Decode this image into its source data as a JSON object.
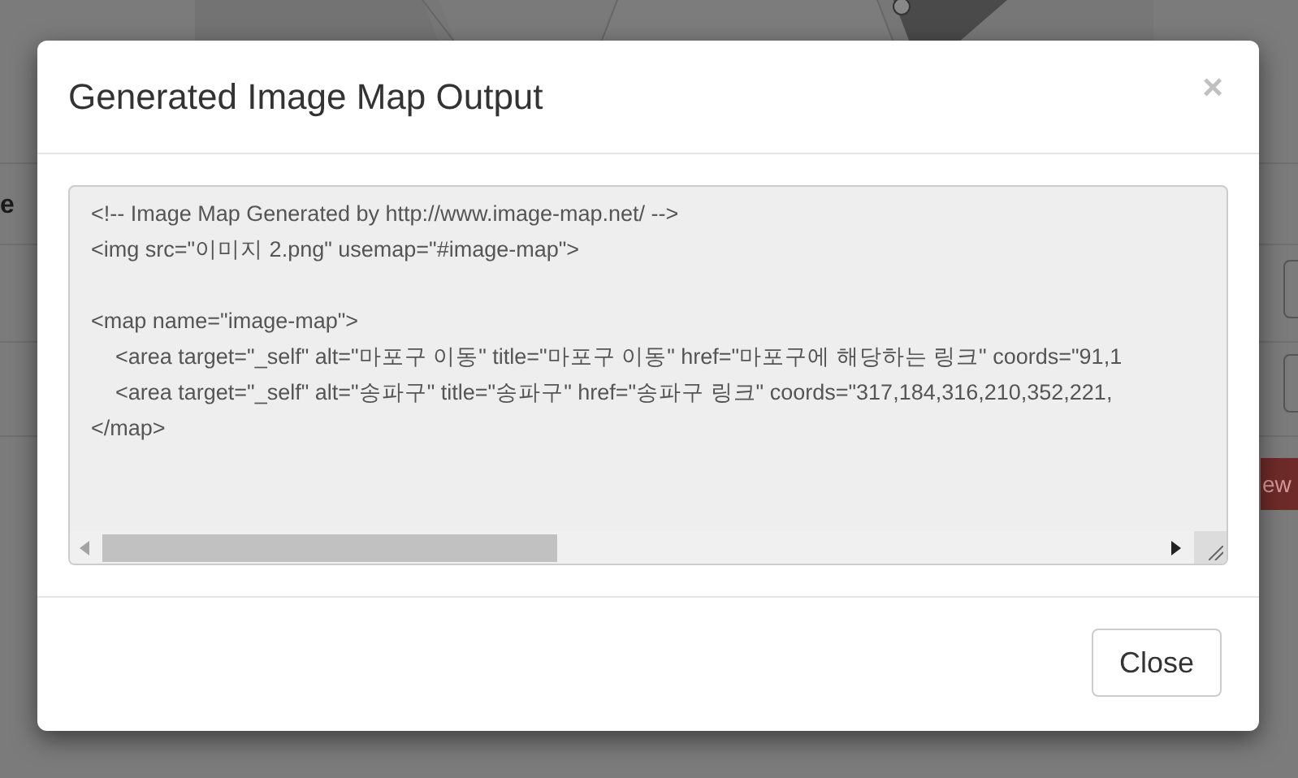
{
  "background": {
    "heading": "e",
    "button": "ew"
  },
  "modal": {
    "title": "Generated Image Map Output",
    "close_icon": "×",
    "code_lines": [
      "<!-- Image Map Generated by http://www.image-map.net/ -->",
      "<img src=\"이미지 2.png\" usemap=\"#image-map\">"
    ],
    "map_lines": [
      "<map name=\"image-map\">",
      "    <area target=\"_self\" alt=\"마포구 이동\" title=\"마포구 이동\" href=\"마포구에 해당하는 링크\" coords=\"91,1",
      "    <area target=\"_self\" alt=\"송파구\" title=\"송파구\" href=\"송파구 링크\" coords=\"317,184,316,210,352,221,",
      "</map>"
    ],
    "footer_button": "Close"
  }
}
